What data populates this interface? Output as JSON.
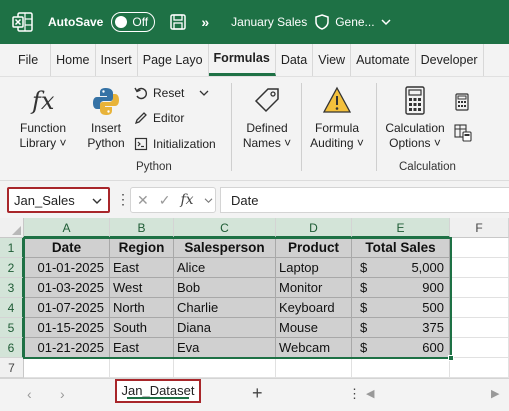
{
  "titlebar": {
    "autosave_label": "AutoSave",
    "autosave_state": "Off",
    "more_label": "»",
    "filename": "January Sales",
    "sensitivity": "Gene...",
    "accent_color": "#1e7145"
  },
  "tabs": [
    "File",
    "Home",
    "Insert",
    "Page Layo",
    "Formulas",
    "Data",
    "View",
    "Automate",
    "Developer"
  ],
  "active_tab": "Formulas",
  "ribbon": {
    "function_library": {
      "line1": "Function",
      "line2": "Library ˅"
    },
    "insert_python": {
      "line1": "Insert",
      "line2": "Python"
    },
    "reset": "Reset",
    "editor": "Editor",
    "initialization": "Initialization",
    "python_group": "Python",
    "defined_names": {
      "line1": "Defined",
      "line2": "Names ˅"
    },
    "formula_auditing": {
      "line1": "Formula",
      "line2": "Auditing ˅"
    },
    "calculation_options": {
      "line1": "Calculation",
      "line2": "Options ˅"
    },
    "calculation_group": "Calculation"
  },
  "formula_bar": {
    "name_box": "Jan_Sales",
    "fx": "fx",
    "formula": "Date"
  },
  "grid": {
    "columns": [
      "A",
      "B",
      "C",
      "D",
      "E",
      "F"
    ],
    "rows": [
      "1",
      "2",
      "3",
      "4",
      "5",
      "6",
      "7"
    ],
    "headers": [
      "Date",
      "Region",
      "Salesperson",
      "Product",
      "Total Sales"
    ],
    "data": [
      [
        "01-01-2025",
        "East",
        "Alice",
        "Laptop",
        "5,000"
      ],
      [
        "01-03-2025",
        "West",
        "Bob",
        "Monitor",
        "900"
      ],
      [
        "01-07-2025",
        "North",
        "Charlie",
        "Keyboard",
        "500"
      ],
      [
        "01-15-2025",
        "South",
        "Diana",
        "Mouse",
        "375"
      ],
      [
        "01-21-2025",
        "East",
        "Eva",
        "Webcam",
        "600"
      ]
    ],
    "currency_symbol": "$"
  },
  "sheets": {
    "active": "Jan_Dataset",
    "add_label": "+"
  }
}
